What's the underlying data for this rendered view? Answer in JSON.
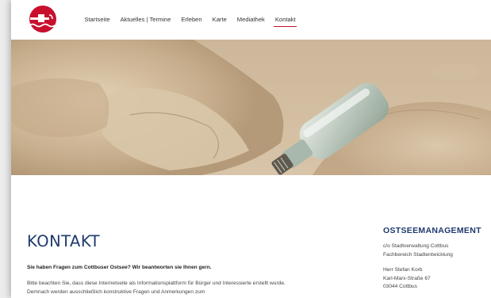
{
  "header": {
    "nav": [
      "Startseite",
      "Aktuelles | Termine",
      "Erleben",
      "Karte",
      "Mediathek",
      "Kontakt"
    ],
    "active_index": 5
  },
  "colors": {
    "brand_red": "#c8102e",
    "heading_blue": "#1e3a6e"
  },
  "hero": {
    "image": "glass-bottle-in-sand"
  },
  "main": {
    "title": "KONTAKT",
    "lead": "Sie haben Fragen zum Cottbuser Ostsee? Wir beantworten sie Ihnen gern.",
    "body": "Bitte beachten Sie, dass diese Internetseite als Informationsplattform für Bürger und Interessierte erstellt wurde. Demnach werden ausschließlich konstruktive Fragen und Anmerkungen zum"
  },
  "aside": {
    "title": "OSTSEEMANAGEMENT",
    "address_lines": [
      "c/o Stadtverwaltung Cottbus",
      "Fachbereich Stadtentwicklung"
    ],
    "person_lines": [
      "Herr Stefan Korb",
      "Karl-Marx-Straße 67",
      "03044 Cottbus"
    ]
  }
}
